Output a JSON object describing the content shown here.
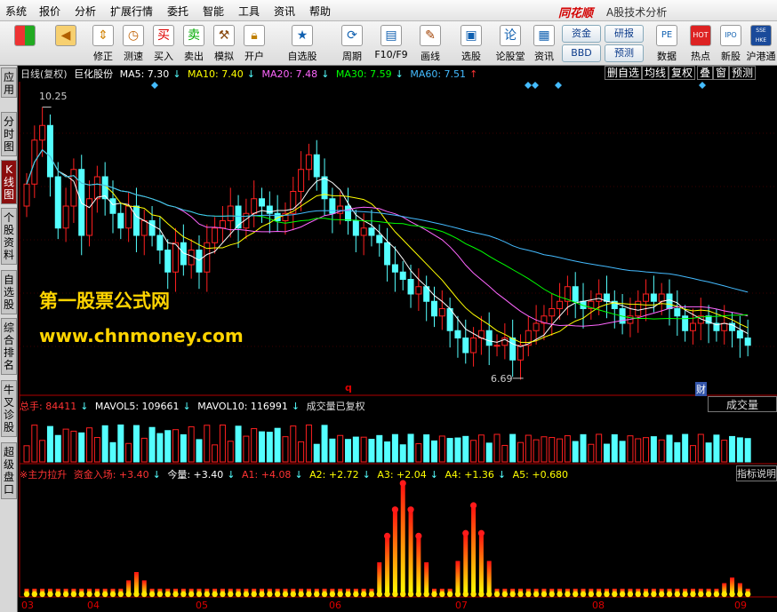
{
  "menu": {
    "items": [
      "系统",
      "报价",
      "分析",
      "扩展行情",
      "委托",
      "智能",
      "工具",
      "资讯",
      "帮助"
    ],
    "logo": "同花顺",
    "app_title": "A股技术分析"
  },
  "toolbar": {
    "buttons": [
      {
        "label": "",
        "icon": "windows-icon"
      },
      {
        "label": "",
        "icon": "back-arrow-icon"
      },
      {
        "label": "修正",
        "icon": "up-down-arrows-icon"
      },
      {
        "label": "测速",
        "icon": "clock-icon"
      },
      {
        "label": "买入",
        "icon": "buy-icon",
        "glyph": "买"
      },
      {
        "label": "卖出",
        "icon": "sell-icon",
        "glyph": "卖"
      },
      {
        "label": "模拟",
        "icon": "gavel-icon"
      },
      {
        "label": "开户",
        "icon": "lock-icon"
      },
      {
        "label": "自选股",
        "icon": "star-folder-icon"
      },
      {
        "label": "周期",
        "icon": "cycle-icon"
      },
      {
        "label": "F10/F9",
        "icon": "f10-icon"
      },
      {
        "label": "画线",
        "icon": "pencil-icon"
      },
      {
        "label": "选股",
        "icon": "screen-icon"
      },
      {
        "label": "论股堂",
        "icon": "discussion-icon",
        "glyph": "论"
      },
      {
        "label": "资讯",
        "icon": "news-icon"
      },
      {
        "label": "数据",
        "icon": "pe-icon",
        "glyph": "PE"
      },
      {
        "label": "热点",
        "icon": "hot-icon",
        "glyph": "HOT"
      },
      {
        "label": "新股",
        "icon": "ipo-icon",
        "glyph": "IPO"
      },
      {
        "label": "沪港通",
        "icon": "sse-hkex-icon",
        "glyph": "SSE HKE"
      }
    ],
    "small_buttons": [
      "资金",
      "研报",
      "BBD",
      "预测"
    ]
  },
  "sidebar": {
    "tabs": [
      "应用",
      "分时图",
      "K线图",
      "个股资料",
      "自选股",
      "综合排名",
      "牛叉诊股",
      "超级盘口"
    ],
    "active_index": 2
  },
  "kline_header": {
    "period": "日线(复权)",
    "stock_name": "巨化股份",
    "ma5": "MA5: 7.30",
    "ma10": "MA10: 7.40",
    "ma20": "MA20: 7.48",
    "ma30": "MA30: 7.59",
    "ma60": "MA60: 7.51",
    "colors": {
      "ma5": "#ffffff",
      "ma10": "#ffff00",
      "ma20": "#ff66ff",
      "ma30": "#00ff00",
      "ma60": "#44bbff"
    }
  },
  "right_tabs": [
    "删自选",
    "均线",
    "复权",
    "叠",
    "窗",
    "预测"
  ],
  "price_labels": {
    "high": "10.25",
    "low": "6.69"
  },
  "markers": {
    "q": "q",
    "cai": "财"
  },
  "watermark": {
    "line1": "第一股票公式网",
    "line2": "www.chnmoney.com"
  },
  "volume_header": {
    "total": "总手: 84411",
    "mavol5": "MAVOL5: 109661",
    "mavol10": "MAVOL10: 116991",
    "note": "成交量已复权",
    "button": "成交量"
  },
  "indicator_header": {
    "name": "※主力拉升",
    "fund": "资金入场: +3.40",
    "now": "今量: +3.40",
    "a1": "A1: +4.08",
    "a2": "A2: +2.72",
    "a3": "A3: +2.04",
    "a4": "A4: +1.36",
    "a5": "A5: +0.680",
    "button": "指标说明"
  },
  "x_axis_months": [
    "03",
    "04",
    "05",
    "06",
    "07",
    "08",
    "09"
  ],
  "colors": {
    "up": "#ff2020",
    "down": "#54ffff",
    "axis": "#b00000"
  },
  "chart_data": {
    "type": "candlestick",
    "ylim": [
      6.5,
      10.5
    ],
    "candles_note": "daily OHLC, approximate",
    "close": [
      9.2,
      9.8,
      10.0,
      9.3,
      8.6,
      8.9,
      9.4,
      8.5,
      9.0,
      9.3,
      9.0,
      8.8,
      8.6,
      8.9,
      8.5,
      8.7,
      8.5,
      8.3,
      8.0,
      8.4,
      8.1,
      8.3,
      8.0,
      8.4,
      8.6,
      8.7,
      8.9,
      8.6,
      8.8,
      9.0,
      8.9,
      8.8,
      8.7,
      8.8,
      9.1,
      9.4,
      9.6,
      9.3,
      9.0,
      8.8,
      8.9,
      8.7,
      8.5,
      8.6,
      8.5,
      8.4,
      8.1,
      8.0,
      7.9,
      7.7,
      7.8,
      7.6,
      7.4,
      7.5,
      7.2,
      7.1,
      6.9,
      7.1,
      7.2,
      7.0,
      7.0,
      7.1,
      6.8,
      7.0,
      7.2,
      7.3,
      7.4,
      7.5,
      7.6,
      7.8,
      7.6,
      7.5,
      7.6,
      7.7,
      7.6,
      7.5,
      7.3,
      7.4,
      7.6,
      7.7,
      7.6,
      7.7,
      7.5,
      7.4,
      7.2,
      7.3,
      7.4,
      7.3,
      7.2,
      7.3,
      7.2,
      7.1,
      7.0
    ],
    "volume_ratio_note": "volume bars in thousands-of-lots, relative"
  }
}
